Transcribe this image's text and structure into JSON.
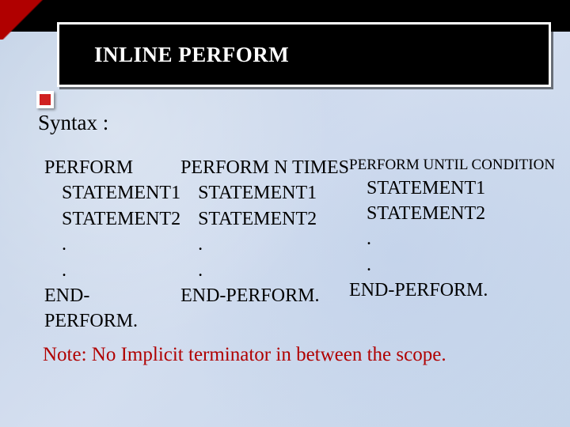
{
  "title": "INLINE PERFORM",
  "syntax_label": "Syntax :",
  "columns": [
    {
      "header": "PERFORM",
      "lines": [
        "STATEMENT1",
        "STATEMENT2",
        ".",
        "."
      ],
      "end": "END-PERFORM."
    },
    {
      "header": "PERFORM N TIMES",
      "lines": [
        "STATEMENT1",
        "STATEMENT2",
        ".",
        "."
      ],
      "end": "END-PERFORM."
    },
    {
      "header": "PERFORM UNTIL CONDITION",
      "lines": [
        "STATEMENT1",
        "STATEMENT2",
        ".",
        "."
      ],
      "end": "END-PERFORM."
    }
  ],
  "note": "Note: No Implicit terminator in between the scope."
}
